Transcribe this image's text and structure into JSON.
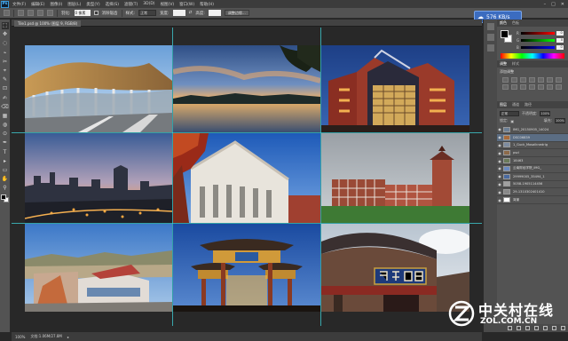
{
  "app": {
    "logo": "Ps"
  },
  "menu": [
    "文件(F)",
    "编辑(E)",
    "图像(I)",
    "图层(L)",
    "类型(Y)",
    "选择(S)",
    "滤镜(T)",
    "3D(D)",
    "视图(V)",
    "窗口(W)",
    "帮助(H)"
  ],
  "window_controls": [
    "–",
    "□",
    "✕"
  ],
  "options_bar": {
    "feather_label": "羽化:",
    "feather_value": "0 像素",
    "antialias_label": "消除锯齿",
    "style_label": "样式:",
    "style_value": "正常",
    "width_label": "宽度:",
    "height_label": "高度:",
    "refine_button": "调整边缘..."
  },
  "document_tab": "Tile1.psd @ 100% (图层 9, RGB/8)",
  "download_badge": {
    "speed": "576 KB/s",
    "icon": "cloud-download-icon"
  },
  "tools": [
    "⬚",
    "✥",
    "◌",
    "⌁",
    "✂",
    "⌖",
    "✎",
    "⊡",
    "✍",
    "⌫",
    "▦",
    "◍",
    "⊙",
    "✒",
    "T",
    "▸",
    "▭",
    "✋",
    "⚲"
  ],
  "panels": {
    "color_tabs": [
      "颜色",
      "色板"
    ],
    "sliders": [
      {
        "label": "R",
        "value": "0",
        "color": "#e03030"
      },
      {
        "label": "G",
        "value": "0",
        "color": "#30b030"
      },
      {
        "label": "B",
        "value": "0",
        "color": "#3060e0"
      }
    ],
    "adj_tabs": [
      "调整",
      "样式"
    ],
    "adj_title": "添加调整",
    "layers_tabs": [
      "图层",
      "通道",
      "路径"
    ],
    "blend_mode": "正常",
    "opacity_label": "不透明度:",
    "opacity_value": "100%",
    "lock_label": "锁定:",
    "fill_label": "填充:",
    "fill_value": "100%",
    "layers": [
      {
        "name": "IMG_20150905_14024",
        "thumb": "#6b7f95",
        "selected": false
      },
      {
        "name": "DSC06839",
        "thumb": "#a86a3a",
        "selected": true
      },
      {
        "name": "1_Guck_Mosaiknedrig",
        "thumb": "#7e8ca0",
        "selected": false
      },
      {
        "name": "pscl",
        "thumb": "#8c6a4a",
        "selected": false
      },
      {
        "name": "18463",
        "thumb": "#6a7a5a",
        "selected": false
      },
      {
        "name": "云南财经学院_IMG_",
        "thumb": "#6a8ac0",
        "selected": false
      },
      {
        "name": "29999005_35494_1",
        "thumb": "#4a6aa0",
        "selected": false
      },
      {
        "name": "5058-1905114456",
        "thumb": "#a0a0a0",
        "selected": false
      },
      {
        "name": "29-1310302401410",
        "thumb": "#888888",
        "selected": false
      },
      {
        "name": "背景",
        "thumb": "#ffffff",
        "selected": false
      }
    ]
  },
  "status": {
    "zoom": "100%",
    "doc_size": "文档:1.06M/27.8M"
  },
  "watermark": {
    "cn": "中关村在线",
    "url": "ZOL.COM.CN"
  }
}
